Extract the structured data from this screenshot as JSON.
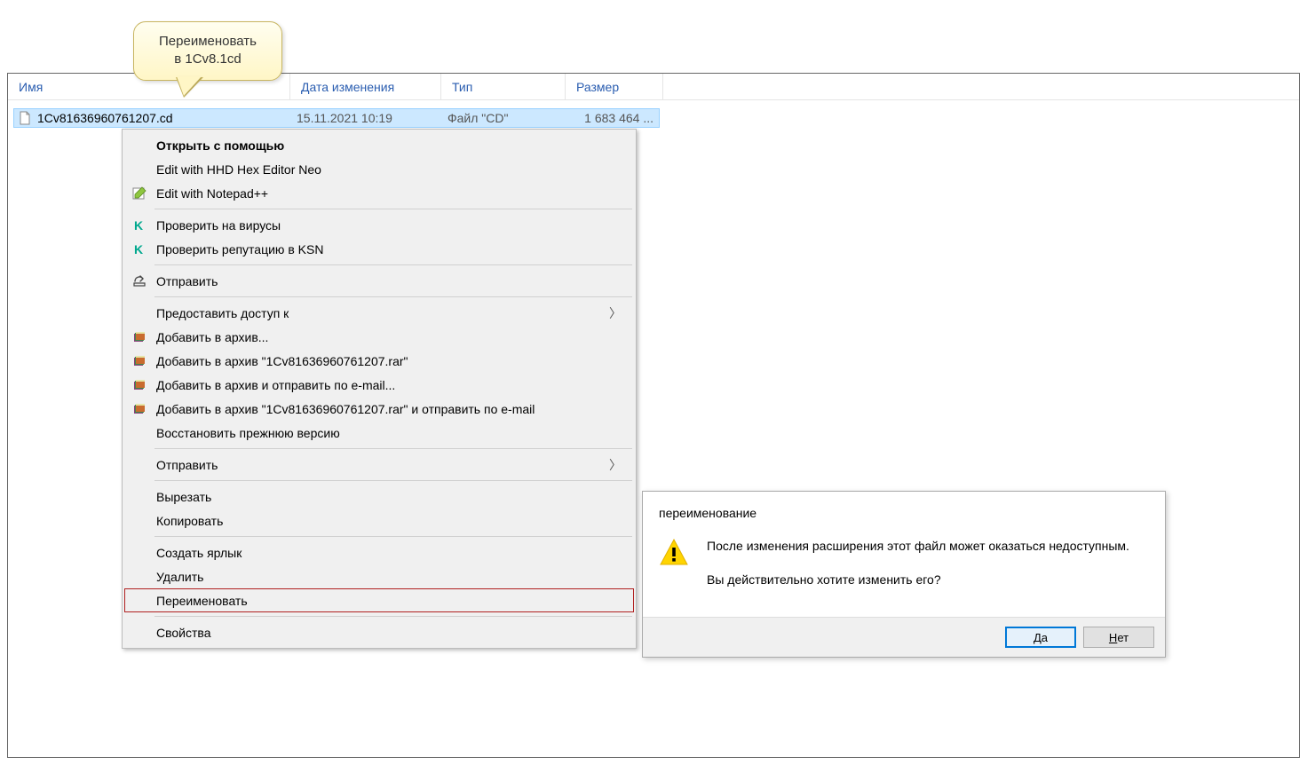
{
  "tooltip": {
    "line1": "Переименовать",
    "line2": "в 1Cv8.1cd"
  },
  "columns": {
    "name": "Имя",
    "date": "Дата изменения",
    "type": "Тип",
    "size": "Размер"
  },
  "file": {
    "name": "1Cv81636960761207.cd",
    "date": "15.11.2021 10:19",
    "type": "Файл \"CD\"",
    "size": "1 683 464 ..."
  },
  "menu": {
    "open_with": "Открыть с помощью",
    "hex_editor": "Edit with HHD Hex Editor Neo",
    "notepadpp": "Edit with Notepad++",
    "scan_virus": "Проверить на вирусы",
    "check_ksn": "Проверить репутацию в KSN",
    "send_share": "Отправить",
    "grant_access": "Предоставить доступ к",
    "add_archive": "Добавить в архив...",
    "add_archive_named": "Добавить в архив \"1Cv81636960761207.rar\"",
    "add_archive_email": "Добавить в архив и отправить по e-mail...",
    "add_archive_named_email": "Добавить в архив \"1Cv81636960761207.rar\" и отправить по e-mail",
    "restore_prev": "Восстановить прежнюю версию",
    "send_to": "Отправить",
    "cut": "Вырезать",
    "copy": "Копировать",
    "create_shortcut": "Создать ярлык",
    "delete": "Удалить",
    "rename": "Переименовать",
    "properties": "Свойства"
  },
  "dialog": {
    "title": "переименование",
    "message1": "После изменения расширения этот файл может оказаться недоступным.",
    "message2": "Вы действительно хотите изменить его?",
    "yes_prefix": "Д",
    "yes_rest": "а",
    "no_prefix": "Н",
    "no_rest": "ет"
  }
}
